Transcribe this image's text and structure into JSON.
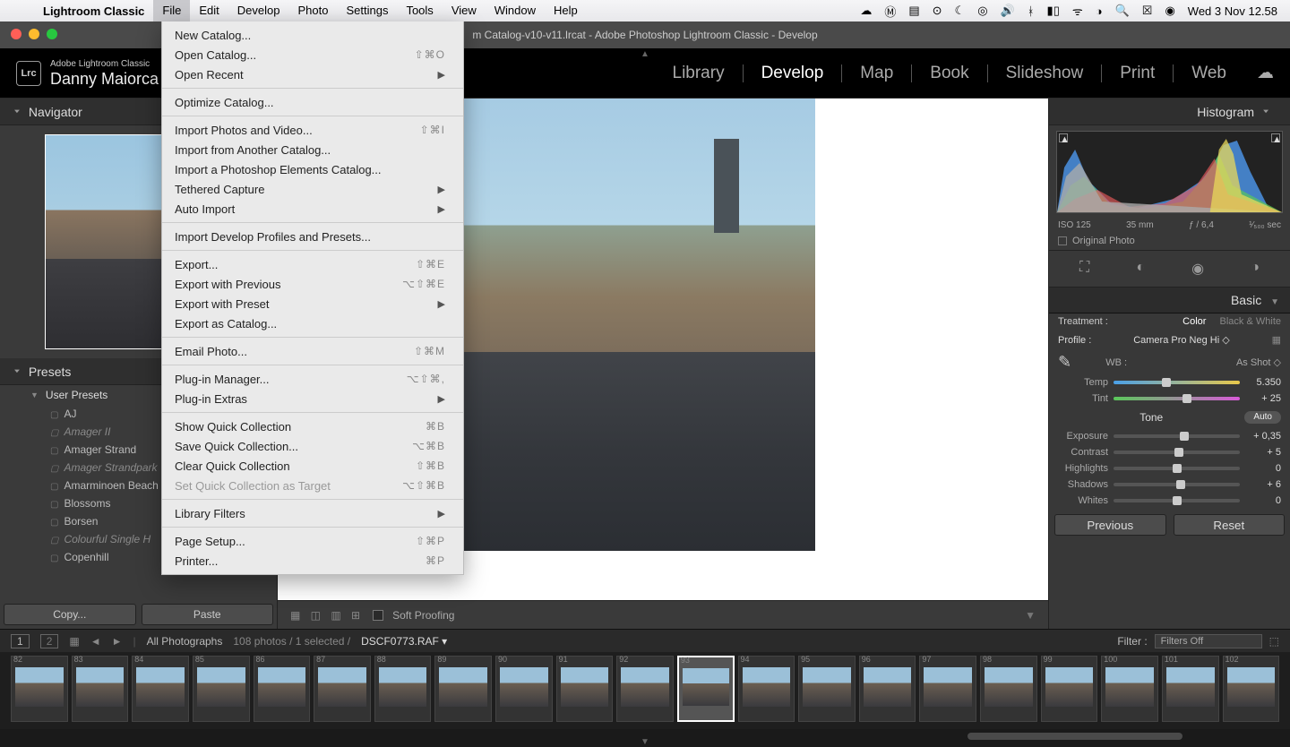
{
  "menubar": {
    "app": "Lightroom Classic",
    "items": [
      "File",
      "Edit",
      "Develop",
      "Photo",
      "Settings",
      "Tools",
      "View",
      "Window",
      "Help"
    ],
    "clock": "Wed 3 Nov  12.58"
  },
  "titlebar": "m Catalog-v10-v11.lrcat - Adobe Photoshop Lightroom Classic - Develop",
  "header": {
    "logo": "Lrc",
    "product": "Adobe Lightroom Classic",
    "user": "Danny Maiorca",
    "modules": [
      "Library",
      "Develop",
      "Map",
      "Book",
      "Slideshow",
      "Print",
      "Web"
    ],
    "active_module": "Develop"
  },
  "file_menu": [
    {
      "label": "New Catalog..."
    },
    {
      "label": "Open Catalog...",
      "shortcut": "⇧⌘O"
    },
    {
      "label": "Open Recent",
      "submenu": true
    },
    {
      "sep": true
    },
    {
      "label": "Optimize Catalog..."
    },
    {
      "sep": true
    },
    {
      "label": "Import Photos and Video...",
      "shortcut": "⇧⌘I"
    },
    {
      "label": "Import from Another Catalog..."
    },
    {
      "label": "Import a Photoshop Elements Catalog..."
    },
    {
      "label": "Tethered Capture",
      "submenu": true
    },
    {
      "label": "Auto Import",
      "submenu": true
    },
    {
      "sep": true
    },
    {
      "label": "Import Develop Profiles and Presets..."
    },
    {
      "sep": true
    },
    {
      "label": "Export...",
      "shortcut": "⇧⌘E"
    },
    {
      "label": "Export with Previous",
      "shortcut": "⌥⇧⌘E"
    },
    {
      "label": "Export with Preset",
      "submenu": true
    },
    {
      "label": "Export as Catalog..."
    },
    {
      "sep": true
    },
    {
      "label": "Email Photo...",
      "shortcut": "⇧⌘M"
    },
    {
      "sep": true
    },
    {
      "label": "Plug-in Manager...",
      "shortcut": "⌥⇧⌘,"
    },
    {
      "label": "Plug-in Extras",
      "submenu": true
    },
    {
      "sep": true
    },
    {
      "label": "Show Quick Collection",
      "shortcut": "⌘B"
    },
    {
      "label": "Save Quick Collection...",
      "shortcut": "⌥⌘B"
    },
    {
      "label": "Clear Quick Collection",
      "shortcut": "⇧⌘B"
    },
    {
      "label": "Set Quick Collection as Target",
      "shortcut": "⌥⇧⌘B",
      "disabled": true
    },
    {
      "sep": true
    },
    {
      "label": "Library Filters",
      "submenu": true
    },
    {
      "sep": true
    },
    {
      "label": "Page Setup...",
      "shortcut": "⇧⌘P"
    },
    {
      "label": "Printer...",
      "shortcut": "⌘P"
    }
  ],
  "left": {
    "navigator": "Navigator",
    "presets_header": "Presets",
    "user_presets": "User Presets",
    "presets": [
      {
        "name": "AJ"
      },
      {
        "name": "Amager II",
        "italic": true
      },
      {
        "name": "Amager Strand"
      },
      {
        "name": "Amager Strandpark",
        "italic": true
      },
      {
        "name": "Amarminoen Beach"
      },
      {
        "name": "Blossoms"
      },
      {
        "name": "Borsen"
      },
      {
        "name": "Colourful Single H",
        "italic": true
      },
      {
        "name": "Copenhill"
      }
    ],
    "copy": "Copy...",
    "paste": "Paste"
  },
  "center": {
    "soft_proofing": "Soft Proofing"
  },
  "right": {
    "histogram": "Histogram",
    "histo_info": {
      "iso": "ISO 125",
      "focal": "35 mm",
      "aperture": "ƒ / 6,4",
      "shutter": "¹⁄₅₀₀ sec"
    },
    "original_photo": "Original Photo",
    "basic": "Basic",
    "treatment": "Treatment :",
    "color": "Color",
    "bw": "Black & White",
    "profile_lbl": "Profile :",
    "profile": "Camera Pro Neg Hi",
    "wb_lbl": "WB :",
    "wb": "As Shot",
    "temp_lbl": "Temp",
    "temp_val": "5.350",
    "tint_lbl": "Tint",
    "tint_val": "+ 25",
    "tone": "Tone",
    "auto": "Auto",
    "sliders": [
      {
        "name": "Exposure",
        "value": "+ 0,35",
        "pos": 56
      },
      {
        "name": "Contrast",
        "value": "+ 5",
        "pos": 52
      },
      {
        "name": "Highlights",
        "value": "0",
        "pos": 50
      },
      {
        "name": "Shadows",
        "value": "+ 6",
        "pos": 53
      },
      {
        "name": "Whites",
        "value": "0",
        "pos": 50
      }
    ],
    "previous": "Previous",
    "reset": "Reset"
  },
  "filmstrip": {
    "label_all": "All Photographs",
    "count": "108 photos / 1 selected /",
    "filename": "DSCF0773.RAF",
    "filter_lbl": "Filter :",
    "filter_val": "Filters Off",
    "frames": [
      82,
      83,
      84,
      85,
      86,
      87,
      88,
      89,
      90,
      91,
      92,
      93,
      94,
      95,
      96,
      97,
      98,
      99,
      100,
      101,
      102
    ],
    "selected": 93,
    "screens": [
      "1",
      "2"
    ]
  }
}
